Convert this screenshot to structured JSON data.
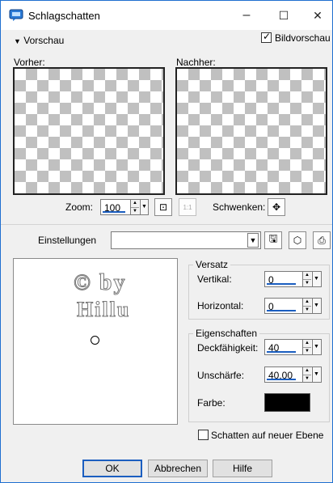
{
  "window": {
    "title": "Schlagschatten",
    "icon": "app-dialog-icon",
    "minimize": "–",
    "maximize": "☐",
    "close": "✕"
  },
  "top": {
    "preview_toggle_label": "Vorschau",
    "image_preview_label": "Bildvorschau",
    "image_preview_checked": true
  },
  "previews": {
    "before_label": "Vorher:",
    "after_label": "Nachher:"
  },
  "zoom": {
    "label": "Zoom:",
    "value": "100",
    "pan_label": "Schwenken:"
  },
  "settings": {
    "label": "Einstellungen",
    "value": ""
  },
  "watermark": {
    "line1": "© by",
    "line2": "Hillu"
  },
  "offset_group": {
    "title": "Versatz",
    "vertical_label": "Vertikal:",
    "vertical_value": "0",
    "horizontal_label": "Horizontal:",
    "horizontal_value": "0"
  },
  "props_group": {
    "title": "Eigenschaften",
    "opacity_label": "Deckfähigkeit:",
    "opacity_value": "40",
    "blur_label": "Unschärfe:",
    "blur_value": "40,00",
    "color_label": "Farbe:",
    "color_value": "#000000"
  },
  "new_layer": {
    "label": "Schatten auf neuer Ebene",
    "checked": false
  },
  "buttons": {
    "ok": "OK",
    "cancel": "Abbrechen",
    "help": "Hilfe"
  }
}
